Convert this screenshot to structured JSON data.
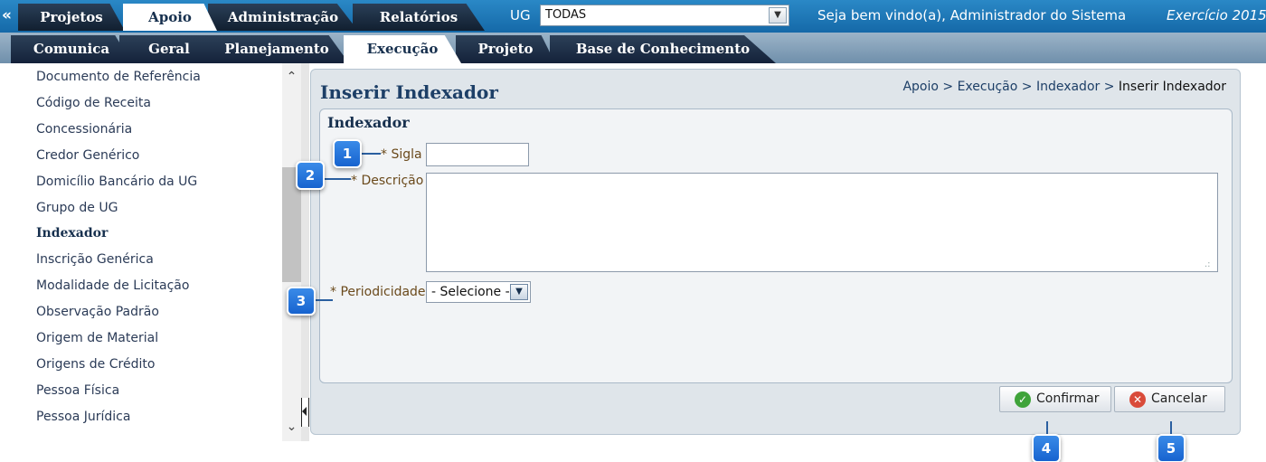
{
  "topbar": {
    "collapse_icon": "«",
    "tabs": [
      {
        "label": "Projetos",
        "active": false
      },
      {
        "label": "Apoio",
        "active": true
      },
      {
        "label": "Administração",
        "active": false
      },
      {
        "label": "Relatórios",
        "active": false
      }
    ],
    "ug_label": "UG",
    "ug_value": "TODAS",
    "welcome": "Seja bem vindo(a), Administrador do Sistema",
    "exercicio": "Exercício 2015"
  },
  "subtabs": [
    {
      "label": "Comunica",
      "active": false
    },
    {
      "label": "Geral",
      "active": false
    },
    {
      "label": "Planejamento",
      "active": false
    },
    {
      "label": "Execução",
      "active": true
    },
    {
      "label": "Projeto",
      "active": false
    },
    {
      "label": "Base de Conhecimento",
      "active": false
    }
  ],
  "sidebar": {
    "items": [
      {
        "label": "Documento de Referência",
        "active": false
      },
      {
        "label": "Código de Receita",
        "active": false
      },
      {
        "label": "Concessionária",
        "active": false
      },
      {
        "label": "Credor Genérico",
        "active": false
      },
      {
        "label": "Domicílio Bancário da UG",
        "active": false
      },
      {
        "label": "Grupo de UG",
        "active": false
      },
      {
        "label": "Indexador",
        "active": true
      },
      {
        "label": "Inscrição Genérica",
        "active": false
      },
      {
        "label": "Modalidade de Licitação",
        "active": false
      },
      {
        "label": "Observação Padrão",
        "active": false
      },
      {
        "label": "Origem de Material",
        "active": false
      },
      {
        "label": "Origens de Crédito",
        "active": false
      },
      {
        "label": "Pessoa Física",
        "active": false
      },
      {
        "label": "Pessoa Jurídica",
        "active": false
      }
    ]
  },
  "page": {
    "title": "Inserir Indexador",
    "breadcrumb": {
      "path": "Apoio > Execução > Indexador > ",
      "current": "Inserir Indexador"
    }
  },
  "form": {
    "panel_title": "Indexador",
    "sigla_label": "* Sigla",
    "sigla_value": "",
    "descricao_label": "* Descrição",
    "descricao_value": "",
    "periodicidade_label": "* Periodicidade",
    "periodicidade_value": "- Selecione -"
  },
  "buttons": {
    "confirm_label": "Confirmar",
    "cancel_label": "Cancelar"
  },
  "callouts": [
    "1",
    "2",
    "3",
    "4",
    "5"
  ],
  "colors": {
    "topbar_blue": "#1f7bbb",
    "tab_dark": "#1a2a40",
    "confirm_green": "#3fa33a",
    "cancel_red": "#d94b3a",
    "callout_blue": "#1f73dc"
  },
  "icons": {
    "confirm": "check-icon",
    "cancel": "close-icon",
    "dropdown": "chevron-down-icon"
  }
}
